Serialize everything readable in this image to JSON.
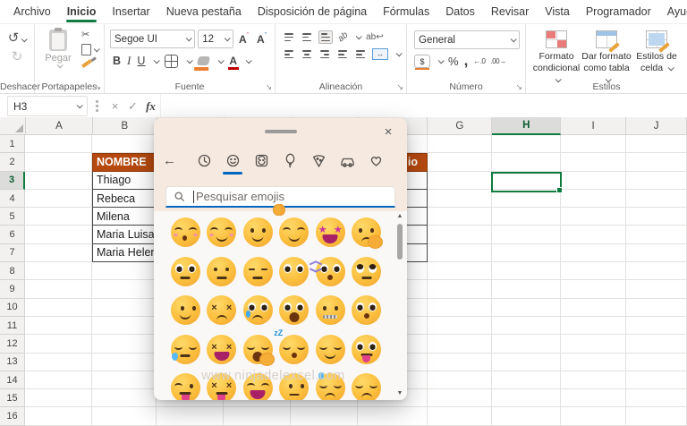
{
  "menu": {
    "items": [
      {
        "label": "Archivo",
        "active": false
      },
      {
        "label": "Inicio",
        "active": true
      },
      {
        "label": "Insertar",
        "active": false
      },
      {
        "label": "Nueva pestaña",
        "active": false
      },
      {
        "label": "Disposición de página",
        "active": false
      },
      {
        "label": "Fórmulas",
        "active": false
      },
      {
        "label": "Datos",
        "active": false
      },
      {
        "label": "Revisar",
        "active": false
      },
      {
        "label": "Vista",
        "active": false
      },
      {
        "label": "Programador",
        "active": false
      },
      {
        "label": "Ayuda",
        "active": false
      }
    ]
  },
  "ribbon": {
    "groups": {
      "deshacer": {
        "label": "Deshacer"
      },
      "portapapeles": {
        "label": "Portapapeles",
        "paste_label": "Pegar"
      },
      "fuente": {
        "label": "Fuente",
        "font_name": "Segoe UI",
        "font_size": "12"
      },
      "alineacion": {
        "label": "Alineación"
      },
      "numero": {
        "label": "Número",
        "format": "General"
      },
      "estilos": {
        "label": "Estilos",
        "buttons": [
          {
            "line1": "Formato",
            "line2": "condicional",
            "icon": "cf"
          },
          {
            "line1": "Dar formato",
            "line2": "como tabla",
            "icon": "tbl"
          },
          {
            "line1": "Estilos de",
            "line2": "celda",
            "icon": "cs"
          }
        ]
      }
    }
  },
  "formula_bar": {
    "name_box": "H3"
  },
  "sheet": {
    "columns": [
      "A",
      "B",
      "C",
      "D",
      "E",
      "F",
      "G",
      "H",
      "I",
      "J"
    ],
    "row_count": 16,
    "selected_cell": "H3",
    "selected_column": "H",
    "selected_row": 3,
    "table": {
      "header_left": "NOMBRE",
      "header_right_partial": "io",
      "names": [
        "Thiago",
        "Rebeca",
        "Milena",
        "Maria Luisa",
        "Maria Helena"
      ]
    }
  },
  "emoji_panel": {
    "close_glyph": "×",
    "back_glyph": "←",
    "search_placeholder": "Pesquisar emojis",
    "watermark": "www.ninjadelexcel.com",
    "tabs": [
      {
        "name": "recent",
        "icon": "clock",
        "selected": false
      },
      {
        "name": "smileys",
        "icon": "smiley",
        "selected": true
      },
      {
        "name": "people",
        "icon": "person",
        "selected": false
      },
      {
        "name": "celebrations",
        "icon": "balloon",
        "selected": false
      },
      {
        "name": "food",
        "icon": "pizza",
        "selected": false
      },
      {
        "name": "travel",
        "icon": "car",
        "selected": false
      },
      {
        "name": "symbols",
        "icon": "heart",
        "selected": false
      }
    ],
    "emojis": [
      {
        "ch": "😚",
        "name": "kissing-face-closed-eyes",
        "eyes": "arc",
        "mouth": "kiss",
        "extra": "blush"
      },
      {
        "ch": "😊",
        "name": "smiling-face-smiling-eyes",
        "eyes": "arc",
        "mouth": "smile",
        "extra": "blush"
      },
      {
        "ch": "🙂",
        "name": "slightly-smiling-face",
        "eyes": "dot",
        "mouth": "smile",
        "extra": null
      },
      {
        "ch": "🤗",
        "name": "hugging-face",
        "eyes": "arc",
        "mouth": "smile",
        "extra": "hands"
      },
      {
        "ch": "🤩",
        "name": "star-struck",
        "eyes": "star",
        "mouth": "wide",
        "extra": null
      },
      {
        "ch": "🤔",
        "name": "thinking-face",
        "eyes": "dot",
        "mouth": "frown",
        "extra": "hand"
      },
      {
        "ch": "😳",
        "name": "flushed-face",
        "eyes": "big",
        "mouth": "flat",
        "extra": null
      },
      {
        "ch": "😐",
        "name": "neutral-face",
        "eyes": "dot",
        "mouth": "flat",
        "extra": null
      },
      {
        "ch": "😑",
        "name": "expressionless-face",
        "eyes": "line",
        "mouth": "flat",
        "extra": null
      },
      {
        "ch": "😶",
        "name": "face-without-mouth",
        "eyes": "big",
        "mouth": "none",
        "extra": null
      },
      {
        "ch": "🫨",
        "name": "shaking-face",
        "eyes": "big",
        "mouth": "o",
        "extra": "rays"
      },
      {
        "ch": "🙄",
        "name": "face-with-rolling-eyes",
        "eyes": "roll",
        "mouth": "flat",
        "extra": null
      },
      {
        "ch": "😏",
        "name": "smirking-face",
        "eyes": "side",
        "mouth": "smile",
        "extra": null
      },
      {
        "ch": "😣",
        "name": "persevering-face",
        "eyes": "x",
        "mouth": "frown",
        "extra": null
      },
      {
        "ch": "😢",
        "name": "crying-face",
        "eyes": "big",
        "mouth": "frown",
        "extra": "tear"
      },
      {
        "ch": "😮",
        "name": "face-with-open-mouth",
        "eyes": "big",
        "mouth": "open",
        "extra": null
      },
      {
        "ch": "🤐",
        "name": "zipper-mouth-face",
        "eyes": "dot",
        "mouth": "zip",
        "extra": null
      },
      {
        "ch": "😯",
        "name": "hushed-face",
        "eyes": "big",
        "mouth": "o",
        "extra": null
      },
      {
        "ch": "😪",
        "name": "sleepy-face",
        "eyes": "closed",
        "mouth": "flat",
        "extra": "drop"
      },
      {
        "ch": "😫",
        "name": "tired-face",
        "eyes": "x",
        "mouth": "wide",
        "extra": null
      },
      {
        "ch": "🥱",
        "name": "yawning-face",
        "eyes": "closed",
        "mouth": "open",
        "extra": "hand"
      },
      {
        "ch": "😴",
        "name": "sleeping-face",
        "eyes": "closed",
        "mouth": "o",
        "extra": "zzz"
      },
      {
        "ch": "😌",
        "name": "relieved-face",
        "eyes": "closed",
        "mouth": "smile",
        "extra": null
      },
      {
        "ch": "😛",
        "name": "face-with-tongue",
        "eyes": "big",
        "mouth": "tongue",
        "extra": null
      },
      {
        "ch": "😜",
        "name": "winking-face-with-tongue",
        "eyes": "wink",
        "mouth": "tongue",
        "extra": null
      },
      {
        "ch": "😝",
        "name": "squinting-face-with-tongue",
        "eyes": "x",
        "mouth": "tongue",
        "extra": null
      },
      {
        "ch": "😆",
        "name": "grinning-squinting-face",
        "eyes": "arc",
        "mouth": "wide",
        "extra": null
      },
      {
        "ch": "😒",
        "name": "unamused-face",
        "eyes": "side",
        "mouth": "flat",
        "extra": null
      },
      {
        "ch": "😓",
        "name": "downcast-face-with-sweat",
        "eyes": "closed",
        "mouth": "frown",
        "extra": "sweat"
      },
      {
        "ch": "😔",
        "name": "pensive-face",
        "eyes": "closed",
        "mouth": "frown",
        "extra": null
      }
    ]
  },
  "colors": {
    "excel_green": "#107C41",
    "table_header_orange": "#B5490F",
    "accent_blue": "#0067C0",
    "panel_beige": "#F6E9E0",
    "emoji_face": "#FBBE3C"
  }
}
